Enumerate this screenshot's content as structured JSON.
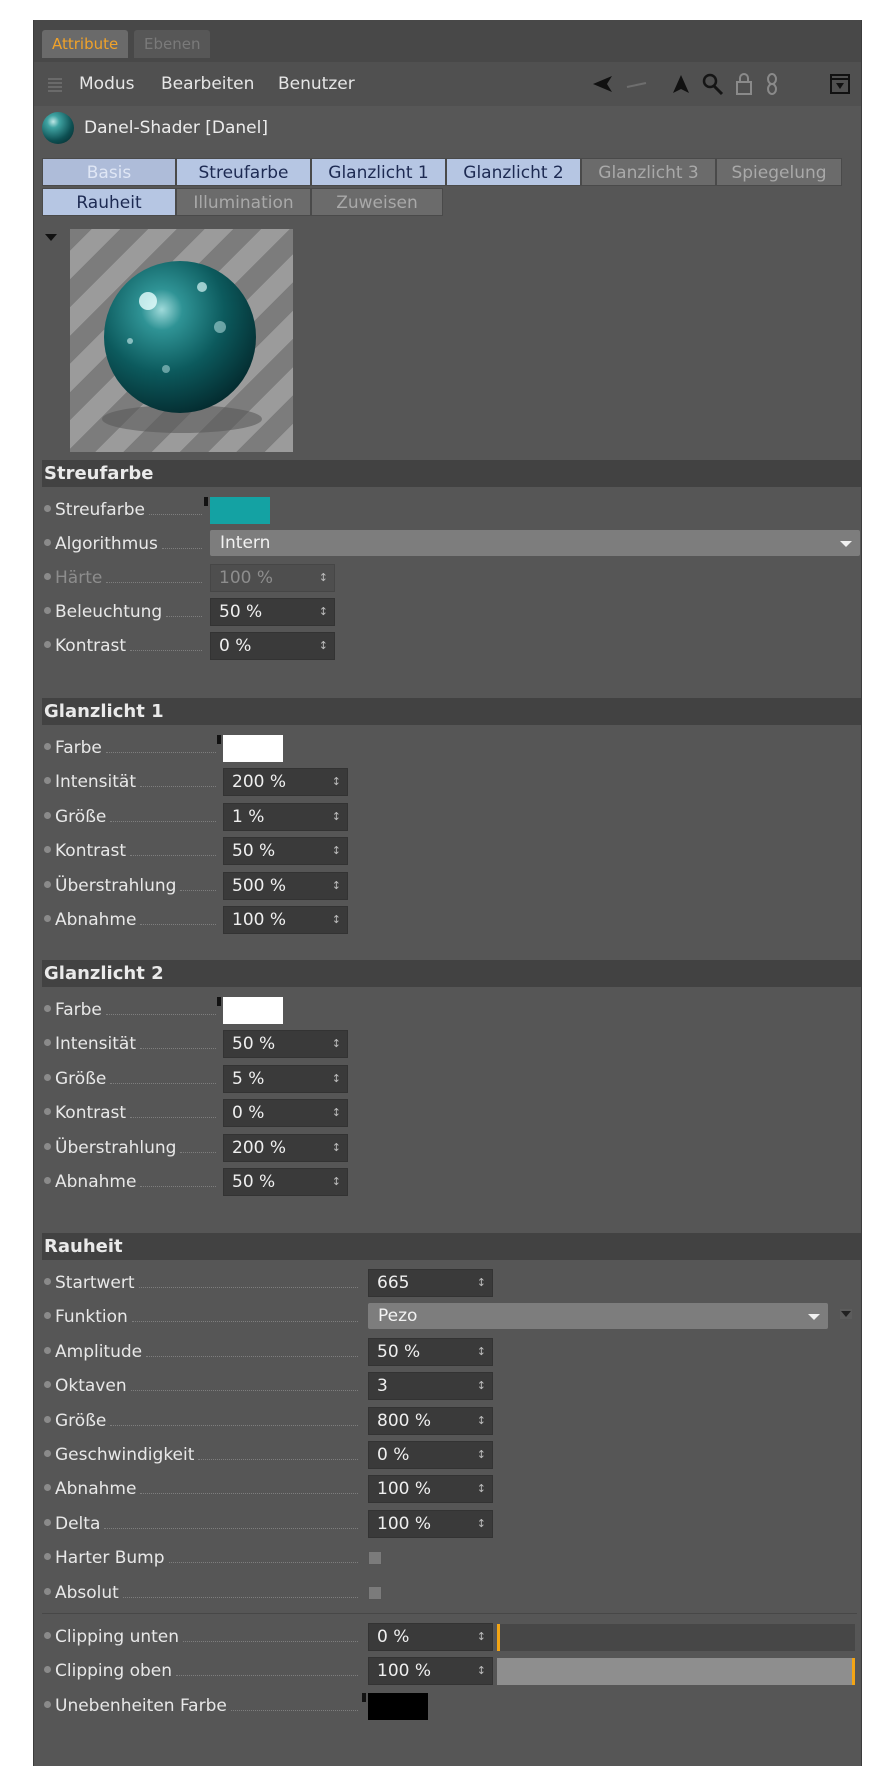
{
  "panel_tabs": [
    {
      "label": "Attribute",
      "active": true
    },
    {
      "label": "Ebenen",
      "active": false
    }
  ],
  "menubar": {
    "items": [
      "Modus",
      "Bearbeiten",
      "Benutzer"
    ],
    "icons": [
      "arrow-back-icon",
      "arrow-up-icon",
      "search-icon",
      "lock-icon",
      "link-icon",
      "maximize-icon"
    ]
  },
  "object": {
    "title": "Danel-Shader [Danel]",
    "icon": "sphere-material-icon"
  },
  "channel_tabs": [
    {
      "label": "Basis",
      "state": "on-dim"
    },
    {
      "label": "Streufarbe",
      "state": "on"
    },
    {
      "label": "Glanzlicht 1",
      "state": "on"
    },
    {
      "label": "Glanzlicht 2",
      "state": "on"
    },
    {
      "label": "Glanzlicht 3",
      "state": "off"
    },
    {
      "label": "Spiegelung",
      "state": "off"
    },
    {
      "label": "Rauheit",
      "state": "on"
    },
    {
      "label": "Illumination",
      "state": "off"
    },
    {
      "label": "Zuweisen",
      "state": "off"
    }
  ],
  "colors": {
    "accent": "#f0a22a",
    "tab_selected": "#b6c6e3",
    "streufarbe_swatch": "#14a2a3",
    "glanz_swatch": "#ffffff",
    "unebenheiten_swatch": "#000000",
    "slider_knob": "#f3a515"
  },
  "sections": {
    "streufarbe": {
      "title": "Streufarbe",
      "rows": [
        {
          "label": "Streufarbe",
          "type": "color"
        },
        {
          "label": "Algorithmus",
          "type": "dropdown",
          "value": "Intern"
        },
        {
          "label": "Härte",
          "type": "number",
          "value": "100 %",
          "disabled": true
        },
        {
          "label": "Beleuchtung",
          "type": "number",
          "value": "50 %"
        },
        {
          "label": "Kontrast",
          "type": "number",
          "value": "0 %"
        }
      ]
    },
    "glanzlicht1": {
      "title": "Glanzlicht 1",
      "rows": [
        {
          "label": "Farbe",
          "type": "color"
        },
        {
          "label": "Intensität",
          "type": "number",
          "value": "200 %"
        },
        {
          "label": "Größe",
          "type": "number",
          "value": "1 %"
        },
        {
          "label": "Kontrast",
          "type": "number",
          "value": "50 %"
        },
        {
          "label": "Überstrahlung",
          "type": "number",
          "value": "500 %"
        },
        {
          "label": "Abnahme",
          "type": "number",
          "value": "100 %"
        }
      ]
    },
    "glanzlicht2": {
      "title": "Glanzlicht 2",
      "rows": [
        {
          "label": "Farbe",
          "type": "color"
        },
        {
          "label": "Intensität",
          "type": "number",
          "value": "50 %"
        },
        {
          "label": "Größe",
          "type": "number",
          "value": "5 %"
        },
        {
          "label": "Kontrast",
          "type": "number",
          "value": "0 %"
        },
        {
          "label": "Überstrahlung",
          "type": "number",
          "value": "200 %"
        },
        {
          "label": "Abnahme",
          "type": "number",
          "value": "50 %"
        }
      ]
    },
    "rauheit": {
      "title": "Rauheit",
      "rows": [
        {
          "label": "Startwert",
          "type": "number",
          "value": "665"
        },
        {
          "label": "Funktion",
          "type": "dropdown",
          "value": "Pezo"
        },
        {
          "label": "Amplitude",
          "type": "number",
          "value": "50 %"
        },
        {
          "label": "Oktaven",
          "type": "number",
          "value": "3"
        },
        {
          "label": "Größe",
          "type": "number",
          "value": "800 %"
        },
        {
          "label": "Geschwindigkeit",
          "type": "number",
          "value": "0 %"
        },
        {
          "label": "Abnahme",
          "type": "number",
          "value": "100 %"
        },
        {
          "label": "Delta",
          "type": "number",
          "value": "100 %"
        },
        {
          "label": "Harter Bump",
          "type": "checkbox",
          "checked": false
        },
        {
          "label": "Absolut",
          "type": "checkbox",
          "checked": false
        },
        {
          "label": "Clipping unten",
          "type": "slider",
          "value": "0 %",
          "fraction": 0
        },
        {
          "label": "Clipping oben",
          "type": "slider",
          "value": "100 %",
          "fraction": 1
        },
        {
          "label": "Unebenheiten Farbe",
          "type": "color"
        }
      ]
    }
  }
}
